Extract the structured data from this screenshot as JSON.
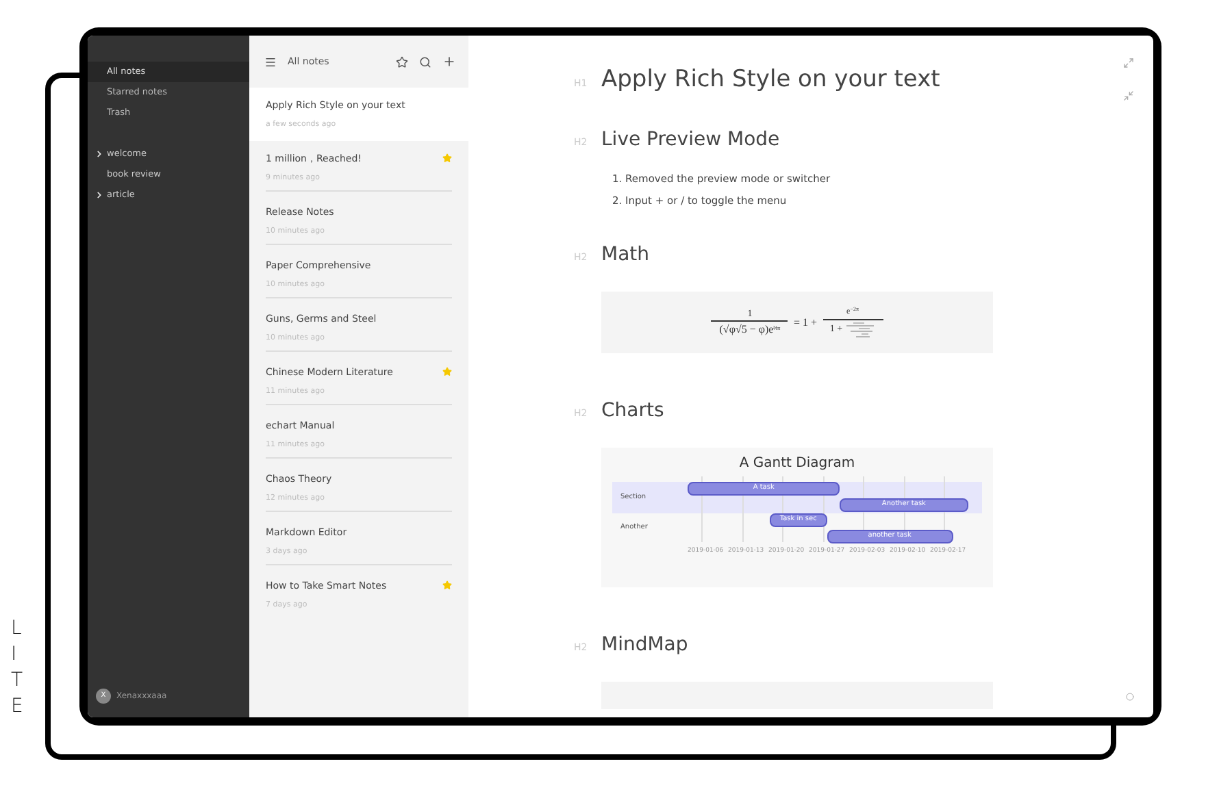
{
  "brand_label": "LITE",
  "sidebar": {
    "items": [
      {
        "label": "All notes",
        "selected": true
      },
      {
        "label": "Starred notes",
        "selected": false
      },
      {
        "label": "Trash",
        "selected": false
      }
    ],
    "folders": [
      {
        "label": "welcome",
        "has_children": true
      },
      {
        "label": "book review",
        "has_children": false
      },
      {
        "label": "article",
        "has_children": true
      }
    ],
    "user": {
      "initial": "X",
      "name": "Xenaxxxaaa"
    }
  },
  "note_list": {
    "title": "All notes",
    "notes": [
      {
        "title": "Apply Rich Style on your text",
        "time": "a few seconds ago",
        "starred": false,
        "selected": true
      },
      {
        "title": "1 million，Reached!",
        "time": "9 minutes ago",
        "starred": true,
        "selected": false
      },
      {
        "title": "Release Notes",
        "time": "10 minutes ago",
        "starred": false,
        "selected": false
      },
      {
        "title": "Paper Comprehensive",
        "time": "10 minutes ago",
        "starred": false,
        "selected": false
      },
      {
        "title": "Guns, Germs and Steel",
        "time": "10 minutes ago",
        "starred": false,
        "selected": false
      },
      {
        "title": "Chinese Modern Literature",
        "time": "11 minutes ago",
        "starred": true,
        "selected": false
      },
      {
        "title": "echart Manual",
        "time": "11 minutes ago",
        "starred": false,
        "selected": false
      },
      {
        "title": "Chaos Theory",
        "time": "12 minutes ago",
        "starred": false,
        "selected": false
      },
      {
        "title": "Markdown Editor",
        "time": "3 days ago",
        "starred": false,
        "selected": false
      },
      {
        "title": "How to Take Smart Notes",
        "time": "7 days ago",
        "starred": true,
        "selected": false
      }
    ]
  },
  "editor": {
    "blocks": [
      {
        "kind": "heading",
        "level": "H1",
        "text": "Apply Rich Style on your text"
      },
      {
        "kind": "heading",
        "level": "H2",
        "text": "Live Preview Mode"
      },
      {
        "kind": "list",
        "items": [
          "1. Removed the preview mode or switcher",
          "2. Input + or / to toggle the menu"
        ]
      },
      {
        "kind": "heading",
        "level": "H2",
        "text": "Math"
      },
      {
        "kind": "math",
        "lhs_num": "1",
        "lhs_den": "(√φ√5 − φ)e",
        "lhs_exp": "⅖π",
        "equals": "= 1 +",
        "rhs_num": "e",
        "rhs_exp": "−2π",
        "rhs_den": "1 +"
      },
      {
        "kind": "heading",
        "level": "H2",
        "text": "Charts"
      },
      {
        "kind": "gantt",
        "title": "A Gantt Diagram",
        "sections": [
          "Section",
          "Another"
        ],
        "tasks": [
          "A task",
          "Another task",
          "Task in sec",
          "another task"
        ],
        "ticks": [
          "2019-01-06",
          "2019-01-13",
          "2019-01-20",
          "2019-01-27",
          "2019-02-03",
          "2019-02-10",
          "2019-02-17"
        ]
      },
      {
        "kind": "heading",
        "level": "H2",
        "text": "MindMap"
      },
      {
        "kind": "mindmap"
      }
    ]
  }
}
